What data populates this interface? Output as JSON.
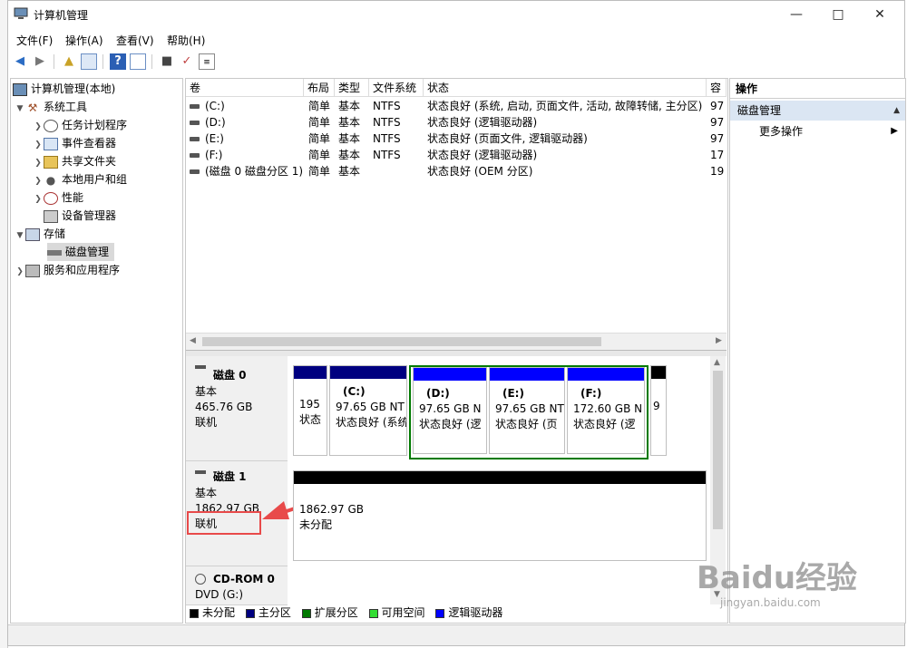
{
  "window": {
    "title": "计算机管理"
  },
  "menu": [
    "文件(F)",
    "操作(A)",
    "查看(V)",
    "帮助(H)"
  ],
  "tree": {
    "root": "计算机管理(本地)",
    "system_tools": "系统工具",
    "task_scheduler": "任务计划程序",
    "event_viewer": "事件查看器",
    "shared_folders": "共享文件夹",
    "local_users": "本地用户和组",
    "performance": "性能",
    "device_manager": "设备管理器",
    "storage": "存储",
    "disk_management": "磁盘管理",
    "services_apps": "服务和应用程序"
  },
  "volume_table": {
    "headers": [
      "卷",
      "布局",
      "类型",
      "文件系统",
      "状态",
      "容"
    ],
    "rows": [
      {
        "vol": "(C:)",
        "layout": "简单",
        "type": "基本",
        "fs": "NTFS",
        "status": "状态良好 (系统, 启动, 页面文件, 活动, 故障转储, 主分区)",
        "cap": "97"
      },
      {
        "vol": "(D:)",
        "layout": "简单",
        "type": "基本",
        "fs": "NTFS",
        "status": "状态良好 (逻辑驱动器)",
        "cap": "97"
      },
      {
        "vol": "(E:)",
        "layout": "简单",
        "type": "基本",
        "fs": "NTFS",
        "status": "状态良好 (页面文件, 逻辑驱动器)",
        "cap": "97"
      },
      {
        "vol": "(F:)",
        "layout": "简单",
        "type": "基本",
        "fs": "NTFS",
        "status": "状态良好 (逻辑驱动器)",
        "cap": "17"
      },
      {
        "vol": "(磁盘 0 磁盘分区 1)",
        "layout": "简单",
        "type": "基本",
        "fs": "",
        "status": "状态良好 (OEM 分区)",
        "cap": "19"
      }
    ]
  },
  "disks": {
    "disk0": {
      "name": "磁盘 0",
      "type": "基本",
      "size": "465.76 GB",
      "state": "联机"
    },
    "disk1": {
      "name": "磁盘 1",
      "type": "基本",
      "size": "1862.97 GB",
      "state": "联机"
    },
    "cdrom": {
      "name": "CD-ROM 0",
      "drive": "DVD (G:)"
    }
  },
  "partitions": {
    "p0": {
      "l1": "195",
      "l2": "状态"
    },
    "c": {
      "l0": "(C:)",
      "l1": "97.65 GB NT",
      "l2": "状态良好 (系统"
    },
    "d": {
      "l0": "(D:)",
      "l1": "97.65 GB N",
      "l2": "状态良好 (逻"
    },
    "e": {
      "l0": "(E:)",
      "l1": "97.65 GB NT",
      "l2": "状态良好 (页"
    },
    "f": {
      "l0": "(F:)",
      "l1": "172.60 GB N",
      "l2": "状态良好 (逻"
    },
    "p9": {
      "l1": "9",
      "l2": ""
    },
    "unalloc": {
      "l1": "1862.97 GB",
      "l2": "未分配"
    }
  },
  "legend": [
    {
      "label": "未分配",
      "color": "#000000"
    },
    {
      "label": "主分区",
      "color": "#000080"
    },
    {
      "label": "扩展分区",
      "color": "#007a00"
    },
    {
      "label": "可用空间",
      "color": "#33dd33"
    },
    {
      "label": "逻辑驱动器",
      "color": "#0000ff"
    }
  ],
  "actions": {
    "header": "操作",
    "section": "磁盘管理",
    "more": "更多操作"
  },
  "watermark": {
    "text": "Baidu经验",
    "sub": "jingyan.baidu.com"
  }
}
